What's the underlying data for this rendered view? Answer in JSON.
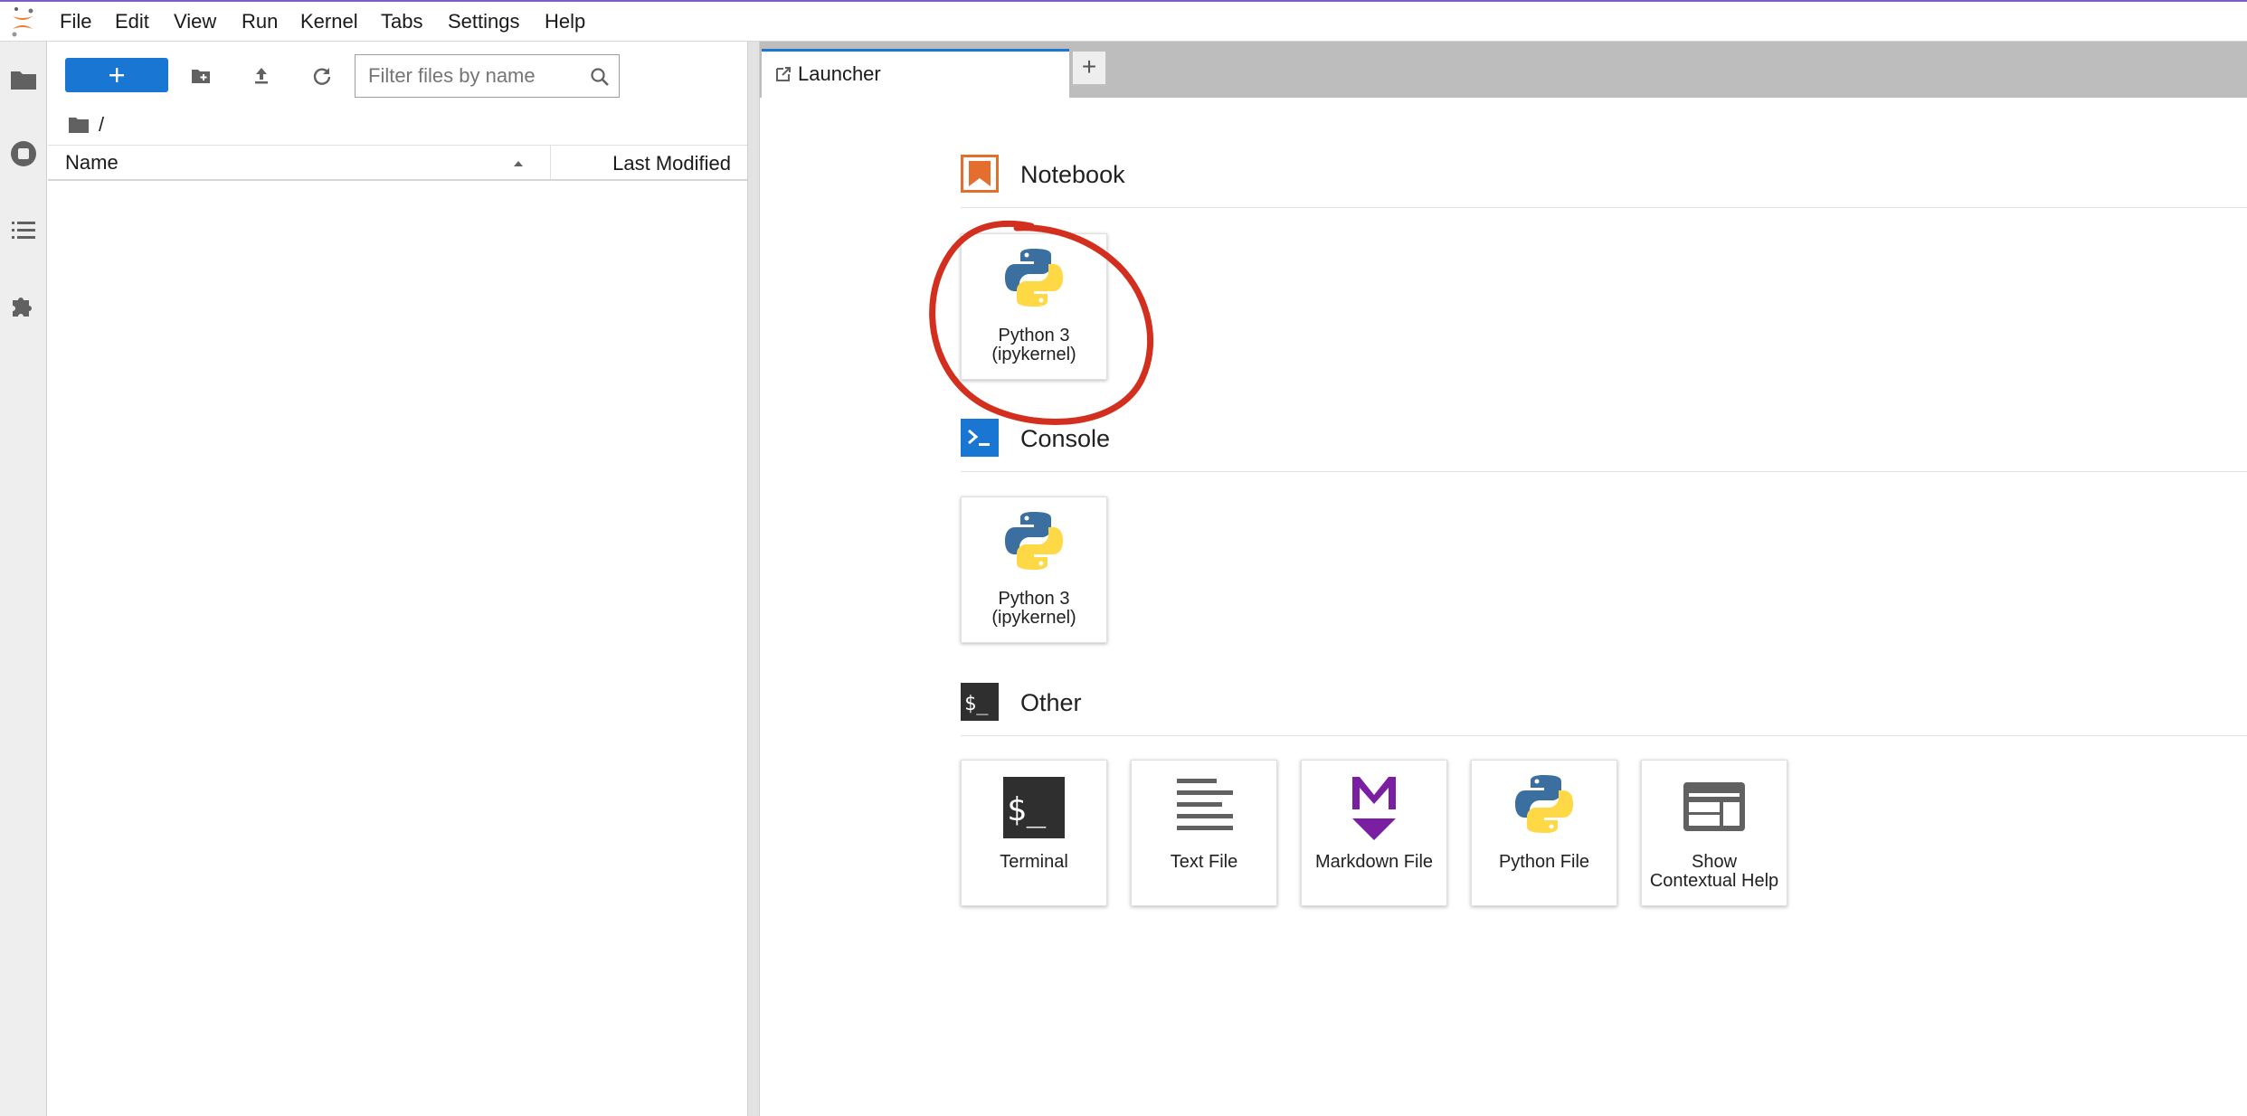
{
  "menubar": {
    "items": [
      "File",
      "Edit",
      "View",
      "Run",
      "Kernel",
      "Tabs",
      "Settings",
      "Help"
    ]
  },
  "activity_bar": {
    "icons": [
      "folder-icon",
      "running-sessions-icon",
      "table-of-contents-icon",
      "extension-puzzle-icon"
    ]
  },
  "file_browser": {
    "new_button_icon": "plus-icon",
    "filter": {
      "placeholder": "Filter files by name",
      "value": ""
    },
    "breadcrumb": {
      "path": "/"
    },
    "columns": {
      "name": "Name",
      "last_modified": "Last Modified"
    },
    "rows": []
  },
  "tabs": [
    {
      "label": "Launcher",
      "active": true
    }
  ],
  "add_tab_label": "+",
  "launcher": {
    "sections": [
      {
        "title": "Notebook",
        "cards": [
          {
            "label": "Python 3 (ipykernel)",
            "line1": "Python 3",
            "line2": "(ipykernel)",
            "icon": "python-logo-icon"
          }
        ]
      },
      {
        "title": "Console",
        "cards": [
          {
            "label": "Python 3 (ipykernel)",
            "line1": "Python 3",
            "line2": "(ipykernel)",
            "icon": "python-logo-icon"
          }
        ]
      },
      {
        "title": "Other",
        "cards": [
          {
            "label": "Terminal",
            "line1": "Terminal",
            "line2": "",
            "icon": "terminal-icon"
          },
          {
            "label": "Text File",
            "line1": "Text File",
            "line2": "",
            "icon": "text-file-icon"
          },
          {
            "label": "Markdown File",
            "line1": "Markdown File",
            "line2": "",
            "icon": "markdown-icon"
          },
          {
            "label": "Python File",
            "line1": "Python File",
            "line2": "",
            "icon": "python-logo-icon"
          },
          {
            "label": "Show Contextual Help",
            "line1": "Show",
            "line2": "Contextual Help",
            "icon": "contextual-help-icon"
          }
        ]
      }
    ]
  },
  "annotation": {
    "type": "hand-drawn circle",
    "target": "notebook-python3-card",
    "color": "#d32f1f"
  },
  "colors": {
    "accent": "#1976d2",
    "notebook_icon": "#e46e2e",
    "console_icon": "#1976d2",
    "markdown_icon": "#7b1fa2",
    "python_blue": "#3b6fa0",
    "python_yellow": "#ffd846",
    "annotation_red": "#d32f1f"
  }
}
